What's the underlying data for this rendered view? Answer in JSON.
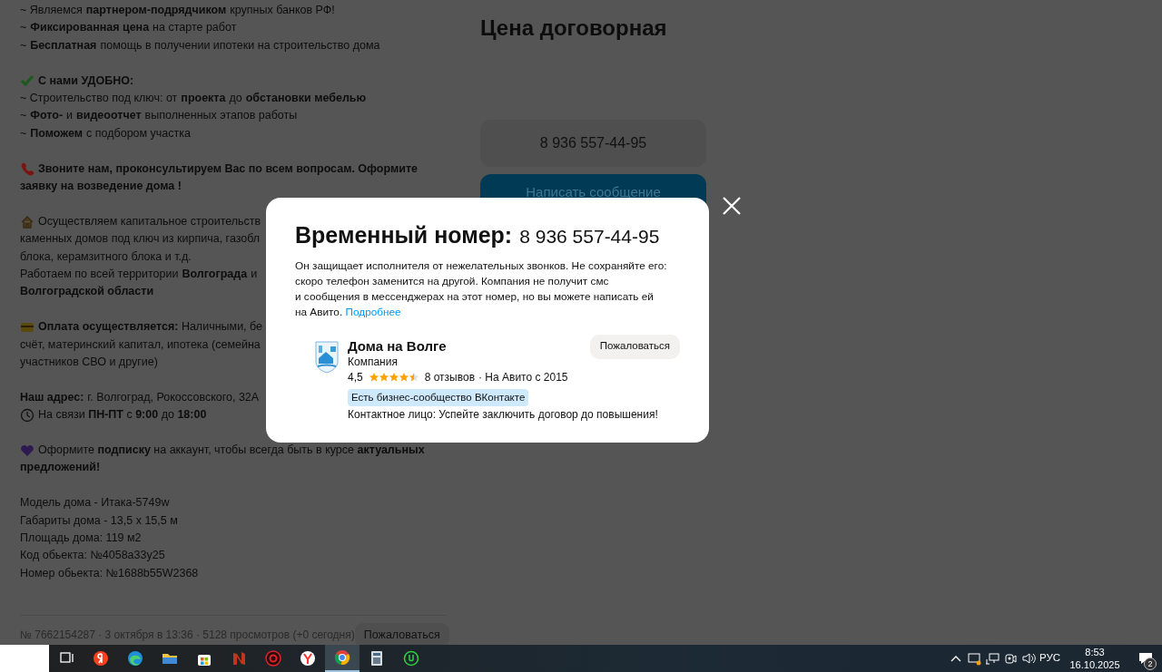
{
  "description": [
    [
      {
        "text": "~ Являемся **партнером-подрядчиком** крупных банков РФ!"
      },
      {
        "text": "~ **Фиксированная цена** на старте работ"
      },
      {
        "text": "~ **Бесплатная** помощь в получении ипотеки на строительство дома"
      }
    ],
    [
      {
        "text": "**С нами УДОБНО:**"
      },
      {
        "text": "~ Строительство под ключ: от **проекта** до **обстановки мебелью**"
      },
      {
        "text": "~ **Фото-** и **видеоотчет** выполненных этапов работы"
      },
      {
        "text": "~ **Поможем** с подбором участка"
      }
    ],
    [
      {
        "text": "**Звоните нам, проконсультируем Вас по всем вопросам. Оформите**"
      },
      {
        "text": "**заявку на возведение дома !**"
      }
    ],
    [
      {
        "text": "Осуществляем капитальное строительств"
      },
      {
        "text": "каменных домов под ключ из кирпича, газобл"
      },
      {
        "text": "блока, керамзитного блока и т.д."
      },
      {
        "text": "Работаем по всей территории **Волгограда** и"
      },
      {
        "text": "**Волгоградской области**"
      }
    ],
    [
      {
        "text": "**Оплата осуществляется:** Наличными, бе"
      },
      {
        "text": "счёт, материнский капитал, ипотека (семейна"
      },
      {
        "text": "участников СВО и другие)"
      }
    ],
    [
      {
        "text": "**Наш адрес:** г. Волгоград, Рокоссовского, 32А"
      },
      {
        "text": "На связи **ПН-ПТ** с **9:00** до **18:00**"
      }
    ],
    [
      {
        "text": "Оформите **подписку** на аккаунт, чтобы всегда быть в курсе **актуальных**"
      },
      {
        "text": "**предложений!**"
      }
    ],
    [
      {
        "text": "Модель дома - Итака-5749w"
      },
      {
        "text": "Габариты дома - 13,5 x 15,5 м"
      },
      {
        "text": "Площадь дома: 119 м2"
      },
      {
        "text": "Код обьекта: №4058a33y25"
      },
      {
        "text": "Номер обьекта: №1688b55W2368"
      }
    ]
  ],
  "footer": {
    "meta": "№ 7662154287 · 3 октября в 13:36 · 5128 просмотров (+0 сегодня)",
    "report_button": "Пожаловаться"
  },
  "price": "Цена договорная",
  "phone_button": "8 936 557-44-95",
  "message_button": "Написать сообщение",
  "modal": {
    "title": "Временный номер:",
    "phone": "8 936 557-44-95",
    "text": "Он защищает исполнителя от нежелательных звонков. Не сохраняйте его:\nскоро телефон заменится на другой. Компания не получит смс\nи сообщения в мессенджерах на этот номер, но вы можете написать ей\nна Авито.",
    "link": "Подробнее",
    "company": {
      "name": "Дома на Волге",
      "type": "Компания",
      "rating": "4,5",
      "stars": 4.5,
      "reviews": "8 отзывов",
      "since": "· На Авито с 2015",
      "badge": "Есть бизнес-сообщество ВКонтакте",
      "contact": "Контактное лицо: Успейте заключить договор до повышения!"
    },
    "report_button": "Пожаловаться"
  },
  "taskbar": {
    "apps": [
      {
        "selected": false
      },
      {
        "selected": false
      },
      {
        "selected": false
      },
      {
        "selected": false
      },
      {
        "selected": false
      },
      {
        "selected": false
      },
      {
        "selected": false
      },
      {
        "selected": false
      },
      {
        "selected": true
      },
      {
        "selected": false
      },
      {
        "selected": false
      }
    ],
    "language": "РУС",
    "time": "8:53",
    "date": "16.10.2025",
    "notifications": "2"
  }
}
